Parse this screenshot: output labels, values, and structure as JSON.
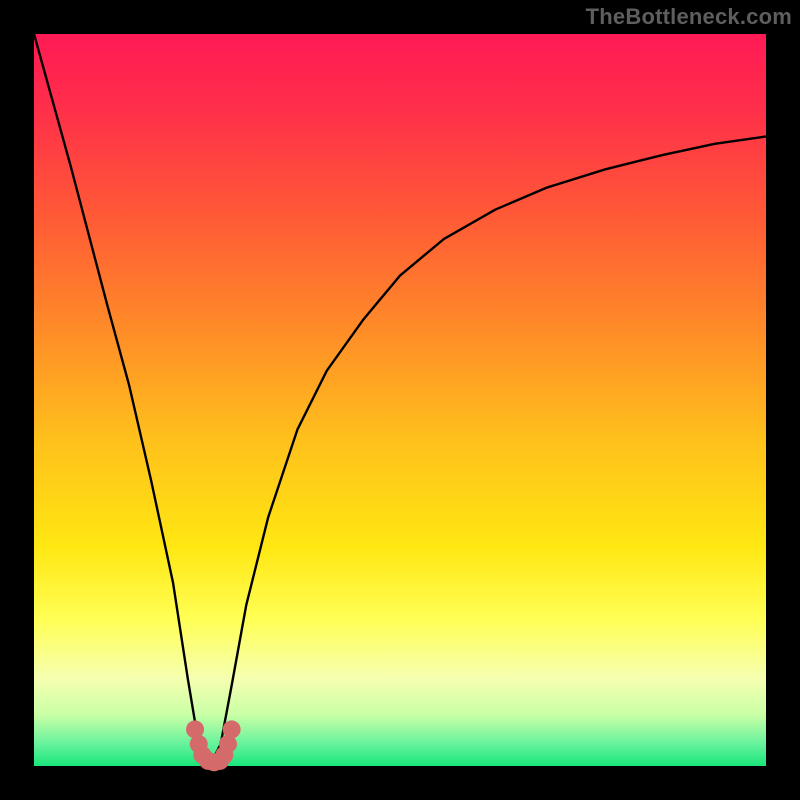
{
  "attribution": "TheBottleneck.com",
  "chart_data": {
    "type": "line",
    "title": "",
    "xlabel": "",
    "ylabel": "",
    "xlim": [
      0,
      100
    ],
    "ylim": [
      0,
      100
    ],
    "grid": false,
    "legend": false,
    "background_gradient": {
      "stops": [
        {
          "offset": 0.0,
          "color": "#ff1a55"
        },
        {
          "offset": 0.1,
          "color": "#ff2e4a"
        },
        {
          "offset": 0.25,
          "color": "#ff5a36"
        },
        {
          "offset": 0.4,
          "color": "#ff8a28"
        },
        {
          "offset": 0.55,
          "color": "#ffbf1c"
        },
        {
          "offset": 0.7,
          "color": "#ffe712"
        },
        {
          "offset": 0.8,
          "color": "#ffff55"
        },
        {
          "offset": 0.88,
          "color": "#f6ffb0"
        },
        {
          "offset": 0.93,
          "color": "#c9ffa6"
        },
        {
          "offset": 0.97,
          "color": "#66f29c"
        },
        {
          "offset": 1.0,
          "color": "#18e67a"
        }
      ]
    },
    "series": [
      {
        "name": "bottleneck-curve",
        "x": [
          0,
          5,
          10,
          13,
          16,
          19,
          21,
          22.5,
          24,
          25.5,
          27,
          29,
          32,
          36,
          40,
          45,
          50,
          56,
          63,
          70,
          78,
          86,
          93,
          100
        ],
        "values": [
          100,
          82,
          63,
          52,
          39,
          25,
          12,
          3,
          0,
          3,
          11,
          22,
          34,
          46,
          54,
          61,
          67,
          72,
          76,
          79,
          81.5,
          83.5,
          85,
          86
        ]
      }
    ],
    "notch_marker": {
      "color": "#d46a6a",
      "points_x": [
        22,
        22.5,
        23,
        23.8,
        24.6,
        25.4,
        26,
        26.5,
        27
      ],
      "points_y": [
        5,
        3,
        1.5,
        0.7,
        0.5,
        0.7,
        1.5,
        3,
        5
      ]
    }
  }
}
